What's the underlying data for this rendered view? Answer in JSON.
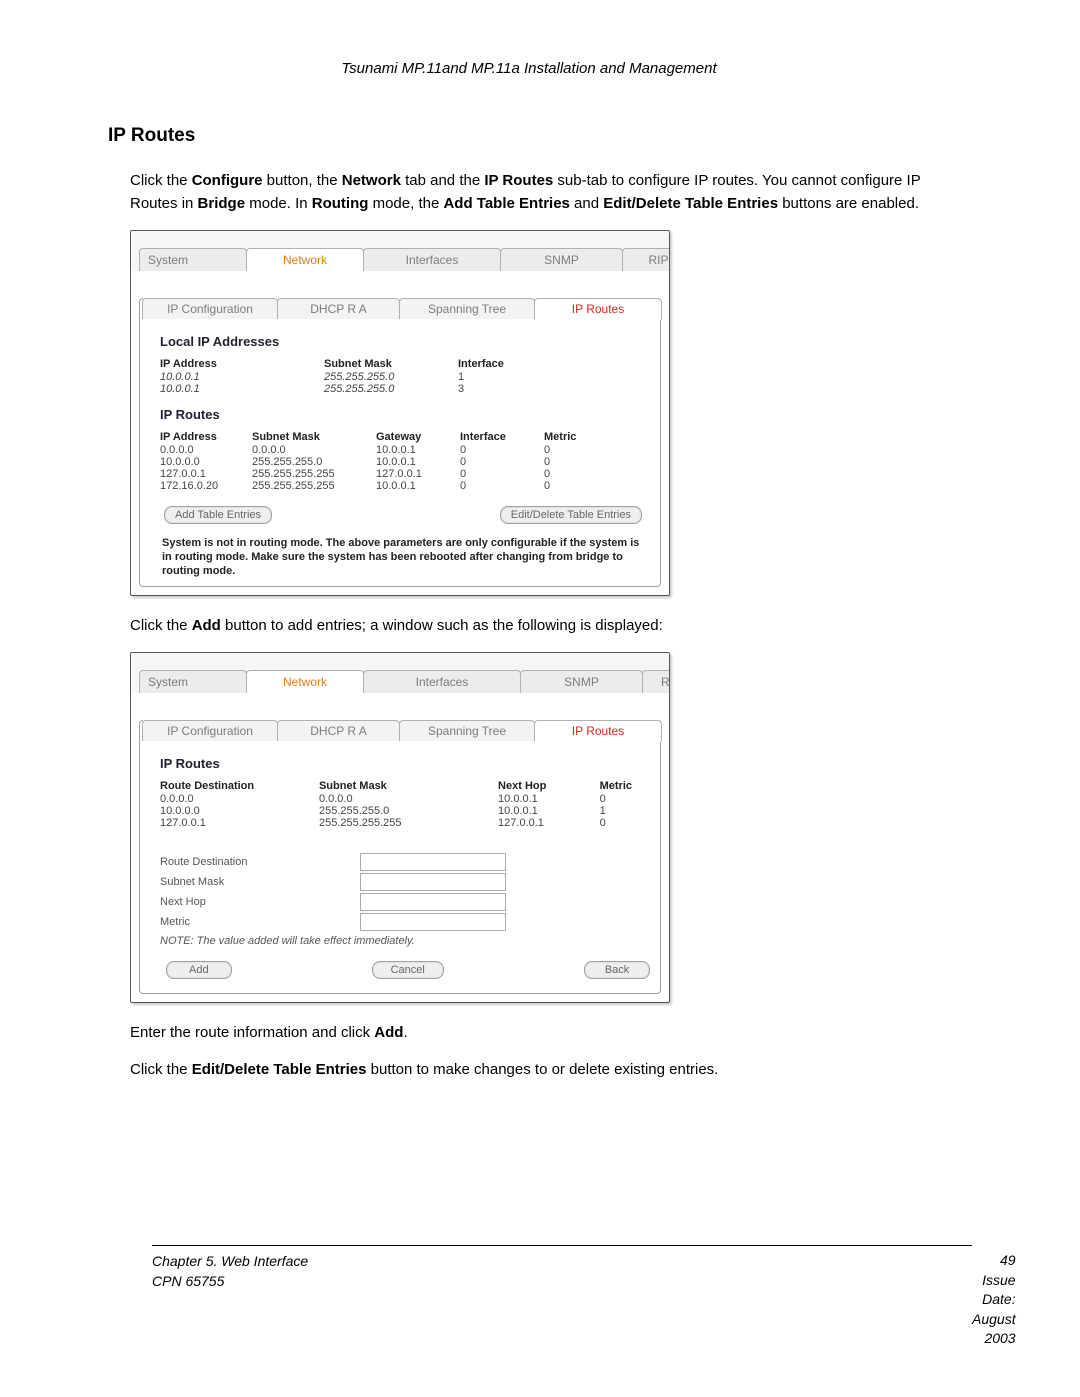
{
  "doc": {
    "header_title": "Tsunami MP.11and MP.11a Installation and Management",
    "h2": "IP Routes",
    "para1_pre": "Click the ",
    "para1_b1": "Configure",
    "para1_mid1": " button, the ",
    "para1_b2": "Network",
    "para1_mid2": " tab and the ",
    "para1_b3": "IP Routes",
    "para1_mid3": " sub-tab to configure IP routes.  You cannot configure IP Routes in ",
    "para1_b4": "Bridge",
    "para1_mid4": " mode.  In ",
    "para1_b5": "Routing",
    "para1_mid5": " mode, the ",
    "para1_b6": "Add Table Entries",
    "para1_mid6": " and ",
    "para1_b7": "Edit/Delete Table Entries",
    "para1_post": " buttons are enabled.",
    "para2_pre": "Click the ",
    "para2_b1": "Add",
    "para2_post": " button to add entries; a window such as the following is displayed:",
    "para3_pre": "Enter the route information and click ",
    "para3_b1": "Add",
    "para3_post": ".",
    "para4_pre": "Click the ",
    "para4_b1": "Edit/Delete Table Entries",
    "para4_post": " button to make changes to or delete existing entries."
  },
  "tabs": {
    "system": "System",
    "network": "Network",
    "interfaces": "Interfaces",
    "snmp": "SNMP",
    "rip": "RIP"
  },
  "subtabs": {
    "ip_configuration": "IP Configuration",
    "dhcp_ra": "DHCP R A",
    "spanning_tree": "Spanning Tree",
    "ip_routes": "IP Routes"
  },
  "shot1": {
    "section_local": "Local IP Addresses",
    "local_headers": {
      "ip": "IP Address",
      "mask": "Subnet Mask",
      "iface": "Interface"
    },
    "local_rows": [
      {
        "ip": "10.0.0.1",
        "mask": "255.255.255.0",
        "iface": "1"
      },
      {
        "ip": "10.0.0.1",
        "mask": "255.255.255.0",
        "iface": "3"
      }
    ],
    "section_routes": "IP Routes",
    "routes_headers": {
      "ip": "IP Address",
      "mask": "Subnet Mask",
      "gw": "Gateway",
      "iface": "Interface",
      "metric": "Metric"
    },
    "routes_rows": [
      {
        "ip": "0.0.0.0",
        "mask": "0.0.0.0",
        "gw": "10.0.0.1",
        "iface": "0",
        "metric": "0"
      },
      {
        "ip": "10.0.0.0",
        "mask": "255.255.255.0",
        "gw": "10.0.0.1",
        "iface": "0",
        "metric": "0"
      },
      {
        "ip": "127.0.0.1",
        "mask": "255.255.255.255",
        "gw": "127.0.0.1",
        "iface": "0",
        "metric": "0"
      },
      {
        "ip": "172.16.0.20",
        "mask": "255.255.255.255",
        "gw": "10.0.0.1",
        "iface": "0",
        "metric": "0"
      }
    ],
    "btn_add": "Add Table Entries",
    "btn_edit": "Edit/Delete Table Entries",
    "warning": "System is not in routing mode. The above parameters are only configurable if the system is in routing mode. Make sure the system has been rebooted after changing from bridge to routing mode."
  },
  "shot2": {
    "section_routes": "IP Routes",
    "headers": {
      "dest": "Route Destination",
      "mask": "Subnet Mask",
      "nexthop": "Next Hop",
      "metric": "Metric"
    },
    "rows": [
      {
        "dest": "0.0.0.0",
        "mask": "0.0.0.0",
        "nexthop": "10.0.0.1",
        "metric": "0"
      },
      {
        "dest": "10.0.0.0",
        "mask": "255.255.255.0",
        "nexthop": "10.0.0.1",
        "metric": "1"
      },
      {
        "dest": "127.0.0.1",
        "mask": "255.255.255.255",
        "nexthop": "127.0.0.1",
        "metric": "0"
      }
    ],
    "form": {
      "route_destination": "Route Destination",
      "subnet_mask": "Subnet Mask",
      "next_hop": "Next Hop",
      "metric": "Metric"
    },
    "note": "NOTE: The value added will take effect immediately.",
    "btn_add": "Add",
    "btn_cancel": "Cancel",
    "btn_back": "Back"
  },
  "footer": {
    "chapter": "Chapter 5.  Web Interface",
    "cpn": "CPN 65755",
    "page": "49",
    "issue": "Issue Date:  August 2003"
  }
}
